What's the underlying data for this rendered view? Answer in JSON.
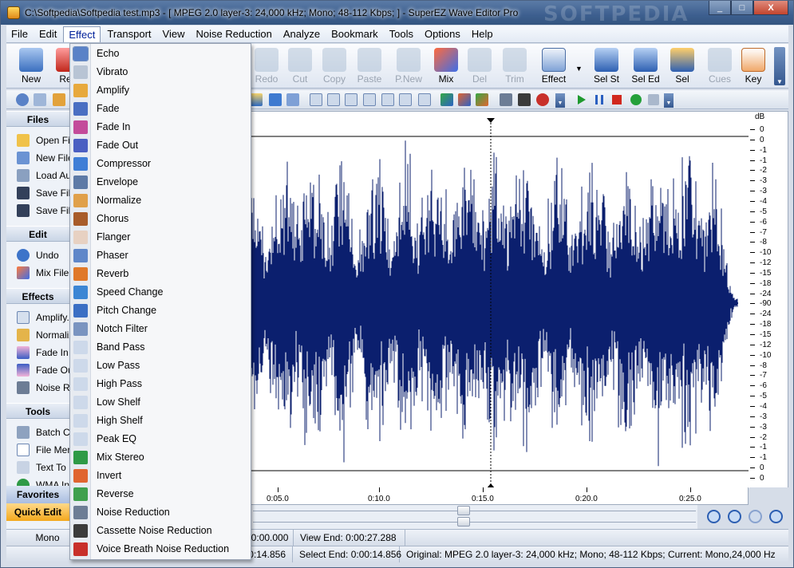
{
  "window": {
    "title": "C:\\Softpedia\\Softpedia test.mp3 - [ MPEG 2.0 layer-3: 24,000 kHz; Mono; 48-112 Kbps;  ] - SuperEZ Wave Editor Pro",
    "watermark": "SOFTPEDIA",
    "minimize": "_",
    "maximize": "□",
    "close": "X"
  },
  "menubar": [
    "File",
    "Edit",
    "Effect",
    "Transport",
    "View",
    "Noise Reduction",
    "Analyze",
    "Bookmark",
    "Tools",
    "Options",
    "Help"
  ],
  "toolbar": {
    "buttons": [
      {
        "label": "New",
        "icon": "new-wave-icon",
        "enabled": true
      },
      {
        "label": "Rec",
        "icon": "record-icon",
        "enabled": true
      },
      {
        "label": "Redo",
        "icon": "redo-icon",
        "enabled": false
      },
      {
        "label": "Cut",
        "icon": "cut-icon",
        "enabled": false
      },
      {
        "label": "Copy",
        "icon": "copy-icon",
        "enabled": false
      },
      {
        "label": "Paste",
        "icon": "paste-icon",
        "enabled": false
      },
      {
        "label": "P.New",
        "icon": "paste-new-icon",
        "enabled": false
      },
      {
        "label": "Mix",
        "icon": "mix-icon",
        "enabled": true
      },
      {
        "label": "Del",
        "icon": "delete-icon",
        "enabled": false
      },
      {
        "label": "Trim",
        "icon": "trim-icon",
        "enabled": false
      },
      {
        "label": "Effect",
        "icon": "effect-icon",
        "enabled": true
      },
      {
        "label": "Sel St",
        "icon": "select-start-icon",
        "enabled": true
      },
      {
        "label": "Sel Ed",
        "icon": "select-end-icon",
        "enabled": true
      },
      {
        "label": "Sel",
        "icon": "select-icon",
        "enabled": true
      },
      {
        "label": "Cues",
        "icon": "cues-icon",
        "enabled": false
      },
      {
        "label": "Key",
        "icon": "key-icon",
        "enabled": true
      }
    ]
  },
  "sidebar": {
    "sections": [
      {
        "title": "Files",
        "items": [
          "Open Fi",
          "New File",
          "Load Au",
          "Save File",
          "Save File"
        ]
      },
      {
        "title": "Edit",
        "items": [
          "Undo",
          "Mix File"
        ]
      },
      {
        "title": "Effects",
        "items": [
          "Amplify.",
          "Normaliz",
          "Fade In",
          "Fade Ou",
          "Noise R"
        ]
      },
      {
        "title": "Tools",
        "items": [
          "Batch C",
          "File Mer",
          "Text To",
          "WMA In"
        ]
      }
    ],
    "favorites": "Favorites",
    "quick_edit": "Quick Edit"
  },
  "effect_menu": {
    "items": [
      "Echo",
      "Vibrato",
      "Amplify",
      "Fade",
      "Fade In",
      "Fade Out",
      "Compressor",
      "Envelope",
      "Normalize",
      "Chorus",
      "Flanger",
      "Phaser",
      "Reverb",
      "Speed Change",
      "Pitch Change",
      "Notch Filter",
      "Band Pass",
      "Low Pass",
      "High Pass",
      "Low Shelf",
      "High Shelf",
      "Peak EQ",
      "Mix Stereo",
      "Invert",
      "Reverse",
      "Noise Reduction",
      "Cassette Noise Reduction",
      "Voice Breath Noise Reduction"
    ]
  },
  "waveform": {
    "color": "#0b1f6e",
    "db_unit": "dB",
    "db_labels": [
      "0",
      "0",
      "-1",
      "-1",
      "-2",
      "-3",
      "-3",
      "-4",
      "-5",
      "-6",
      "-7",
      "-8",
      "-10",
      "-12",
      "-15",
      "-18",
      "-24",
      "-90",
      "-24",
      "-18",
      "-15",
      "-12",
      "-10",
      "-8",
      "-7",
      "-6",
      "-5",
      "-4",
      "-3",
      "-3",
      "-2",
      "-1",
      "-1",
      "0",
      "0"
    ],
    "time_labels": [
      "0:05.0",
      "0:10.0",
      "0:15.0",
      "0:20.0",
      "0:25.0"
    ]
  },
  "status": {
    "row1": {
      "mode": "Mono",
      "view_start": "0:00:00.000",
      "view_end": "View End: 0:00:27.288"
    },
    "row2": {
      "position": "0:00:14.856",
      "select_end": "Select End: 0:00:14.856",
      "info": "Original: MPEG 2.0 layer-3: 24,000 kHz; Mono; 48-112 Kbps;  Current: Mono,24,000 Hz"
    }
  }
}
